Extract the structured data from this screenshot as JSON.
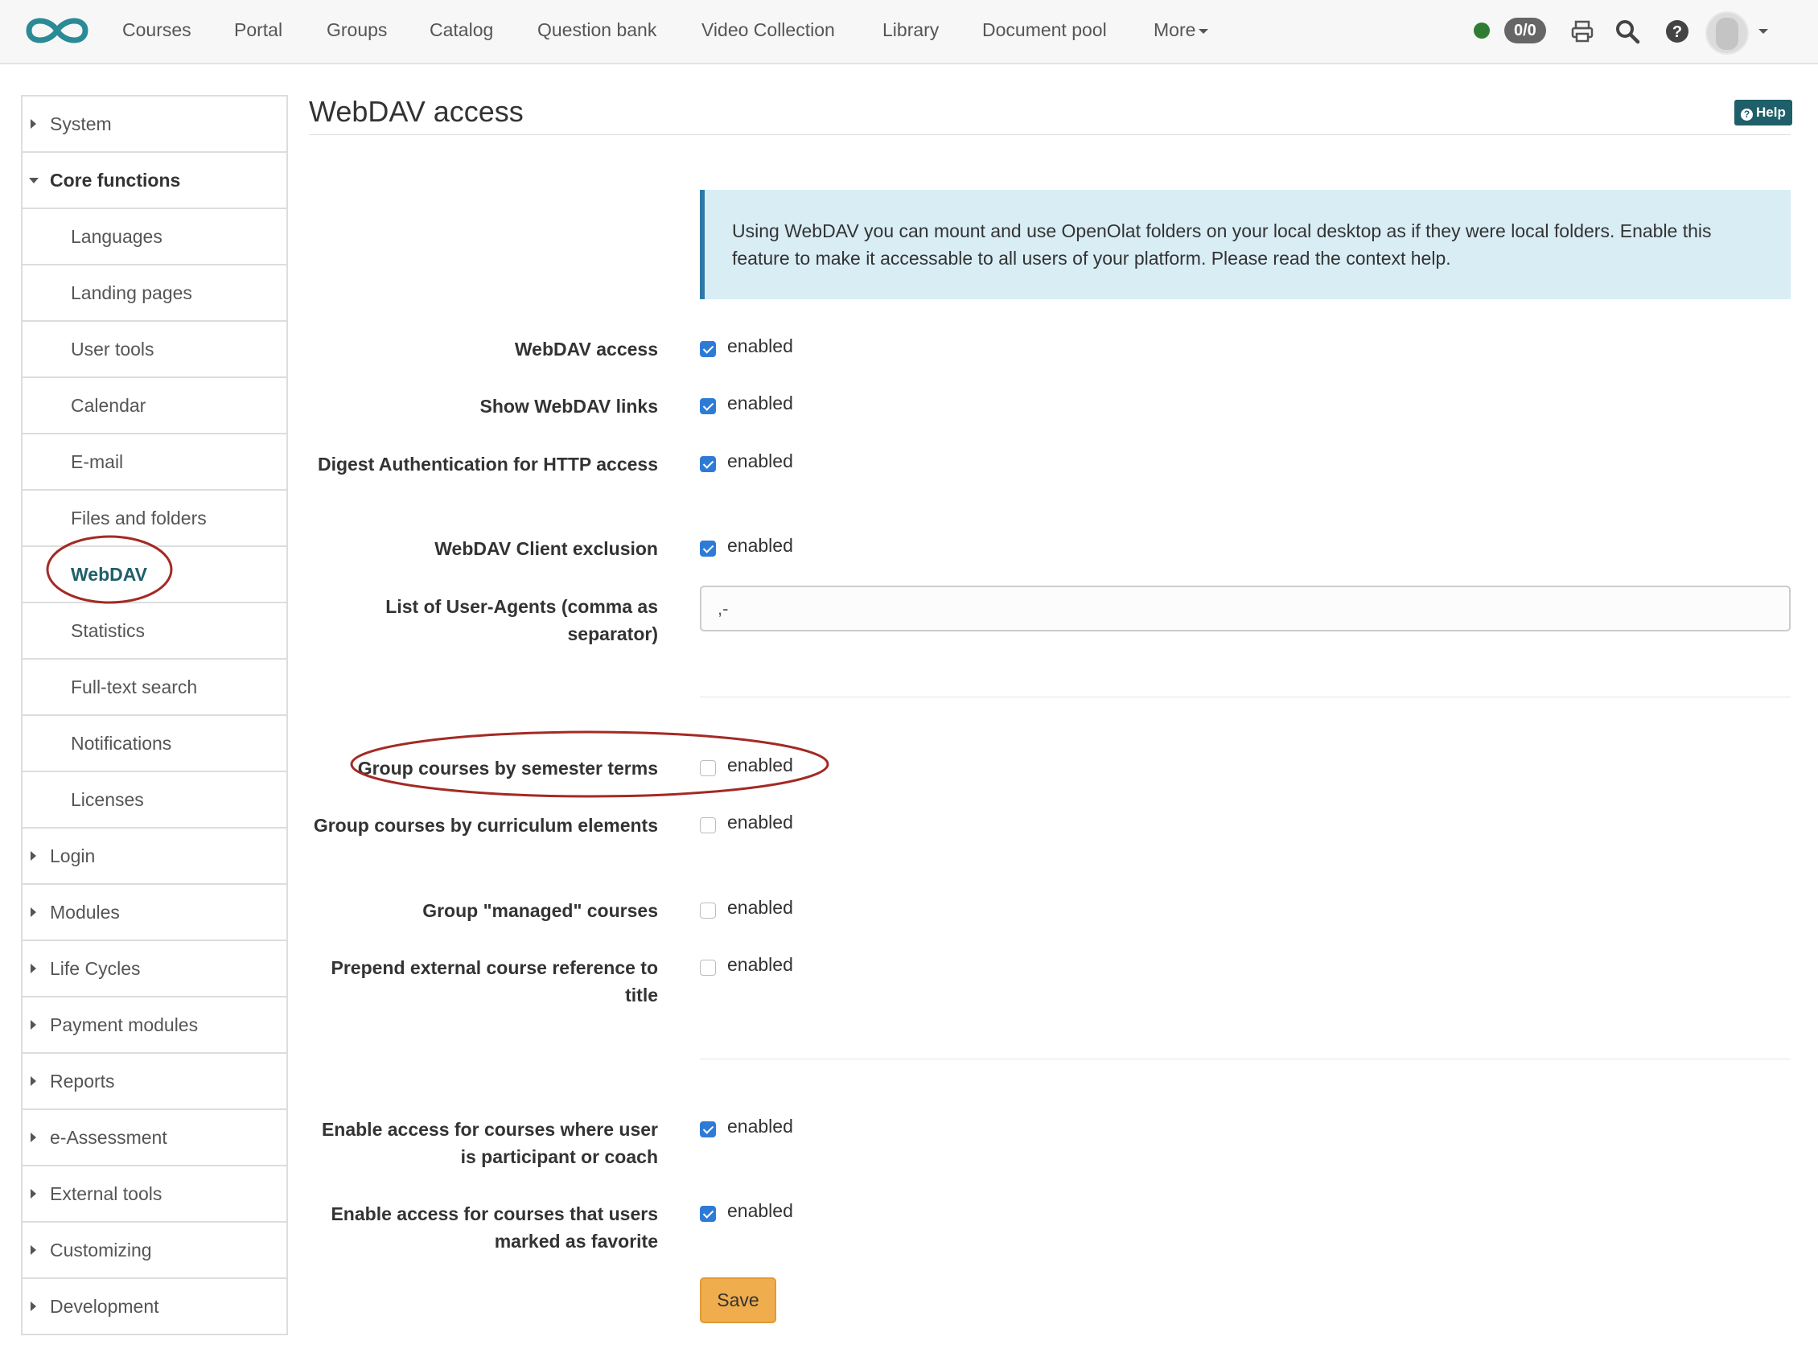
{
  "topnav": {
    "items": [
      "Courses",
      "Portal",
      "Groups",
      "Catalog",
      "Question bank",
      "Video Collection",
      "Library",
      "Document pool",
      "More"
    ],
    "badge": "0/0",
    "icons": [
      "status-dot",
      "print-icon",
      "search-icon",
      "help-circle-icon",
      "avatar",
      "chevron-down-icon"
    ],
    "status_color": "#2e7d32"
  },
  "sidebar": {
    "items": [
      {
        "label": "System",
        "level": "top",
        "state": "collapsed"
      },
      {
        "label": "Core functions",
        "level": "top",
        "state": "expanded"
      },
      {
        "label": "Languages",
        "level": "sub"
      },
      {
        "label": "Landing pages",
        "level": "sub"
      },
      {
        "label": "User tools",
        "level": "sub"
      },
      {
        "label": "Calendar",
        "level": "sub"
      },
      {
        "label": "E-mail",
        "level": "sub"
      },
      {
        "label": "Files and folders",
        "level": "sub"
      },
      {
        "label": "WebDAV",
        "level": "sub",
        "state": "active"
      },
      {
        "label": "Statistics",
        "level": "sub"
      },
      {
        "label": "Full-text search",
        "level": "sub"
      },
      {
        "label": "Notifications",
        "level": "sub"
      },
      {
        "label": "Licenses",
        "level": "sub"
      },
      {
        "label": "Login",
        "level": "top",
        "state": "collapsed"
      },
      {
        "label": "Modules",
        "level": "top",
        "state": "collapsed"
      },
      {
        "label": "Life Cycles",
        "level": "top",
        "state": "collapsed"
      },
      {
        "label": "Payment modules",
        "level": "top",
        "state": "collapsed"
      },
      {
        "label": "Reports",
        "level": "top",
        "state": "collapsed"
      },
      {
        "label": "e-Assessment",
        "level": "top",
        "state": "collapsed"
      },
      {
        "label": "External tools",
        "level": "top",
        "state": "collapsed"
      },
      {
        "label": "Customizing",
        "level": "top",
        "state": "collapsed"
      },
      {
        "label": "Development",
        "level": "top",
        "state": "collapsed"
      }
    ]
  },
  "main": {
    "title": "WebDAV access",
    "help_label": "Help",
    "info": "Using WebDAV you can mount and use OpenOlat folders on your local desktop as if they were local folders. Enable this feature to make it accessable to all users of your platform. Please read the context help.",
    "options": [
      {
        "label": "WebDAV access",
        "checked": true,
        "value_label": "enabled"
      },
      {
        "label": "Show WebDAV links",
        "checked": true,
        "value_label": "enabled"
      },
      {
        "label": "Digest Authentication for HTTP access",
        "checked": true,
        "value_label": "enabled"
      },
      {
        "label": "WebDAV Client exclusion",
        "checked": true,
        "value_label": "enabled"
      },
      {
        "label": "Group courses by semester terms",
        "checked": false,
        "value_label": "enabled"
      },
      {
        "label": "Group courses by curriculum elements",
        "checked": false,
        "value_label": "enabled"
      },
      {
        "label": "Group \"managed\" courses",
        "checked": false,
        "value_label": "enabled"
      },
      {
        "label": "Prepend external course reference to title",
        "checked": false,
        "value_label": "enabled"
      },
      {
        "label": "Enable access for courses where user is participant or coach",
        "checked": true,
        "value_label": "enabled"
      },
      {
        "label": "Enable access for courses that users marked as favorite",
        "checked": true,
        "value_label": "enabled"
      }
    ],
    "user_agents": {
      "label": "List of User-Agents (comma as separator)",
      "value": ",-"
    },
    "save_label": "Save"
  },
  "colors": {
    "accent": "#1e5f6a",
    "checkbox_on": "#2e7bd6",
    "info_bg": "#d9edf5",
    "info_border": "#2d7aa6",
    "save_bg": "#f0ad4e",
    "annotation": "#a32a24"
  }
}
